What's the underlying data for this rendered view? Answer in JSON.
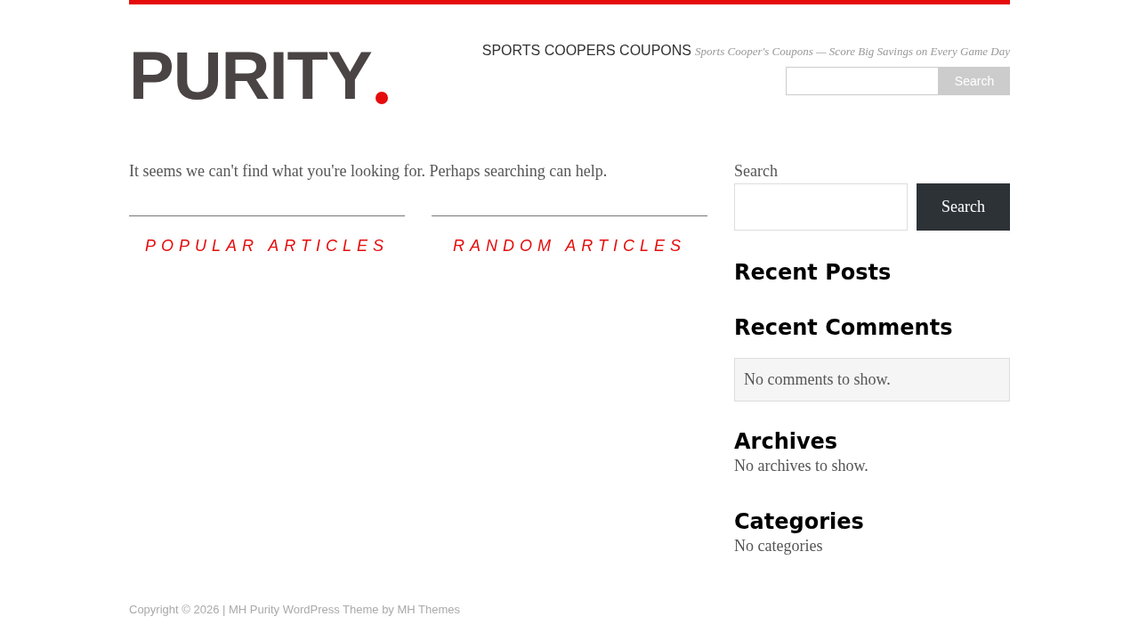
{
  "header": {
    "logo": "PURITY",
    "site_title": "SPORTS COOPERS COUPONS",
    "tagline": "Sports Cooper's Coupons — Score Big Savings on Every Game Day",
    "search": {
      "button": "Search"
    }
  },
  "main": {
    "message": "It seems we can't find what you're looking for. Perhaps searching can help.",
    "sections": [
      "POPULAR ARTICLES",
      "RANDOM ARTICLES"
    ]
  },
  "sidebar": [
    {
      "kind": "search",
      "title": "Search",
      "button": "Search"
    },
    {
      "kind": "heading",
      "title": "Recent Posts"
    },
    {
      "kind": "boxed",
      "title": "Recent Comments",
      "text": "No comments to show."
    },
    {
      "kind": "plain",
      "title": "Archives",
      "text": "No archives to show."
    },
    {
      "kind": "plain",
      "title": "Categories",
      "text": "No categories"
    }
  ],
  "footer": "Copyright © 2026 | MH Purity WordPress Theme by MH Themes"
}
